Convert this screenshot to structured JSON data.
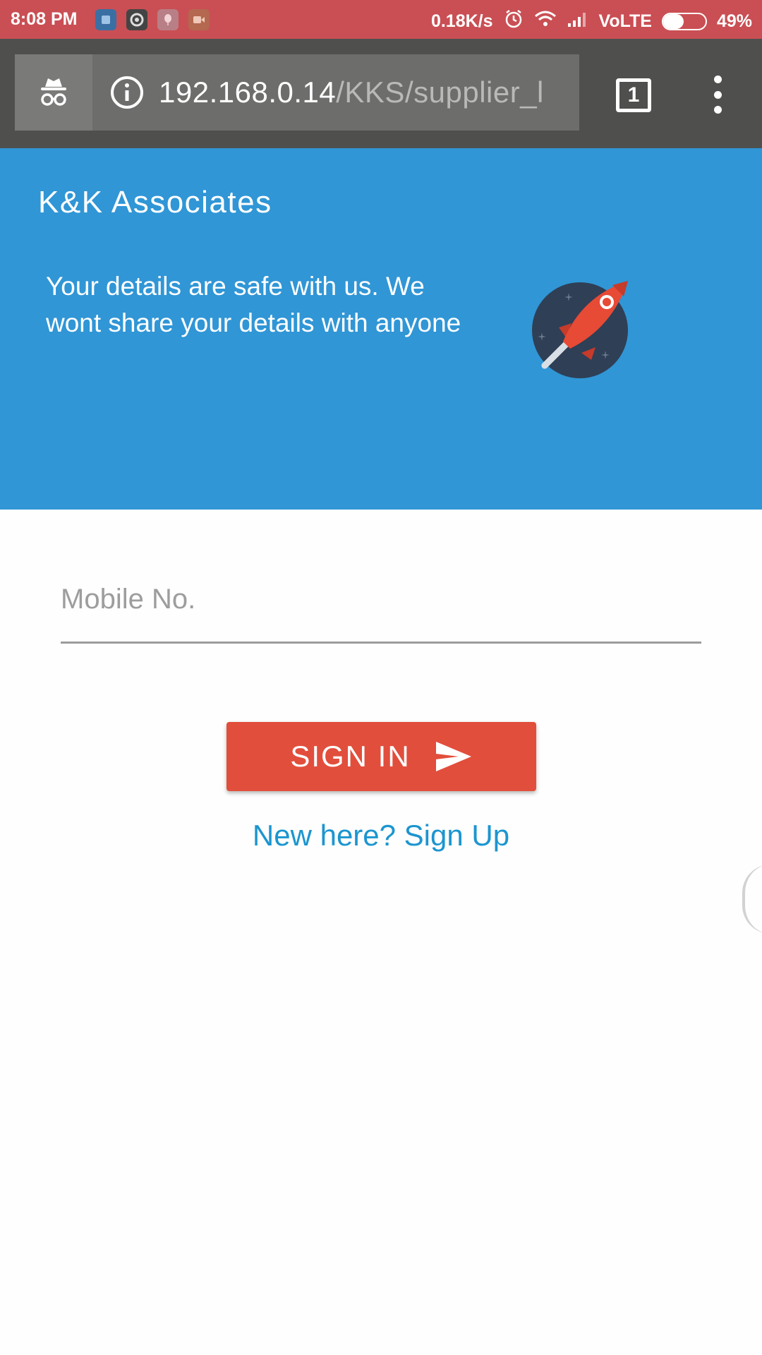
{
  "status_bar": {
    "time": "8:08 PM",
    "network_speed": "0.18K/s",
    "network_type": "VoLTE",
    "battery_percent": "49%",
    "battery_level": 0.49,
    "notification_icons": [
      "message-app-icon",
      "chrome-icon",
      "balloon-app-icon",
      "video-recorder-icon"
    ],
    "background_color": "#c94f54"
  },
  "browser": {
    "url_host": "192.168.0.14",
    "url_path": "/KKS/supplier_l",
    "tab_count": "1",
    "toolbar_color": "#4f504e"
  },
  "hero": {
    "brand": "K&K Associates",
    "tagline": "Your details are safe with us. We wont share your details with anyone",
    "illustration": "rocket-icon",
    "background_color": "#3096d6"
  },
  "form": {
    "mobile_placeholder": "Mobile No.",
    "mobile_value": "",
    "signin_label": "SIGN IN",
    "signin_color": "#e24e3c",
    "signup_link": "New here? Sign Up",
    "link_color": "#1c95d0"
  }
}
